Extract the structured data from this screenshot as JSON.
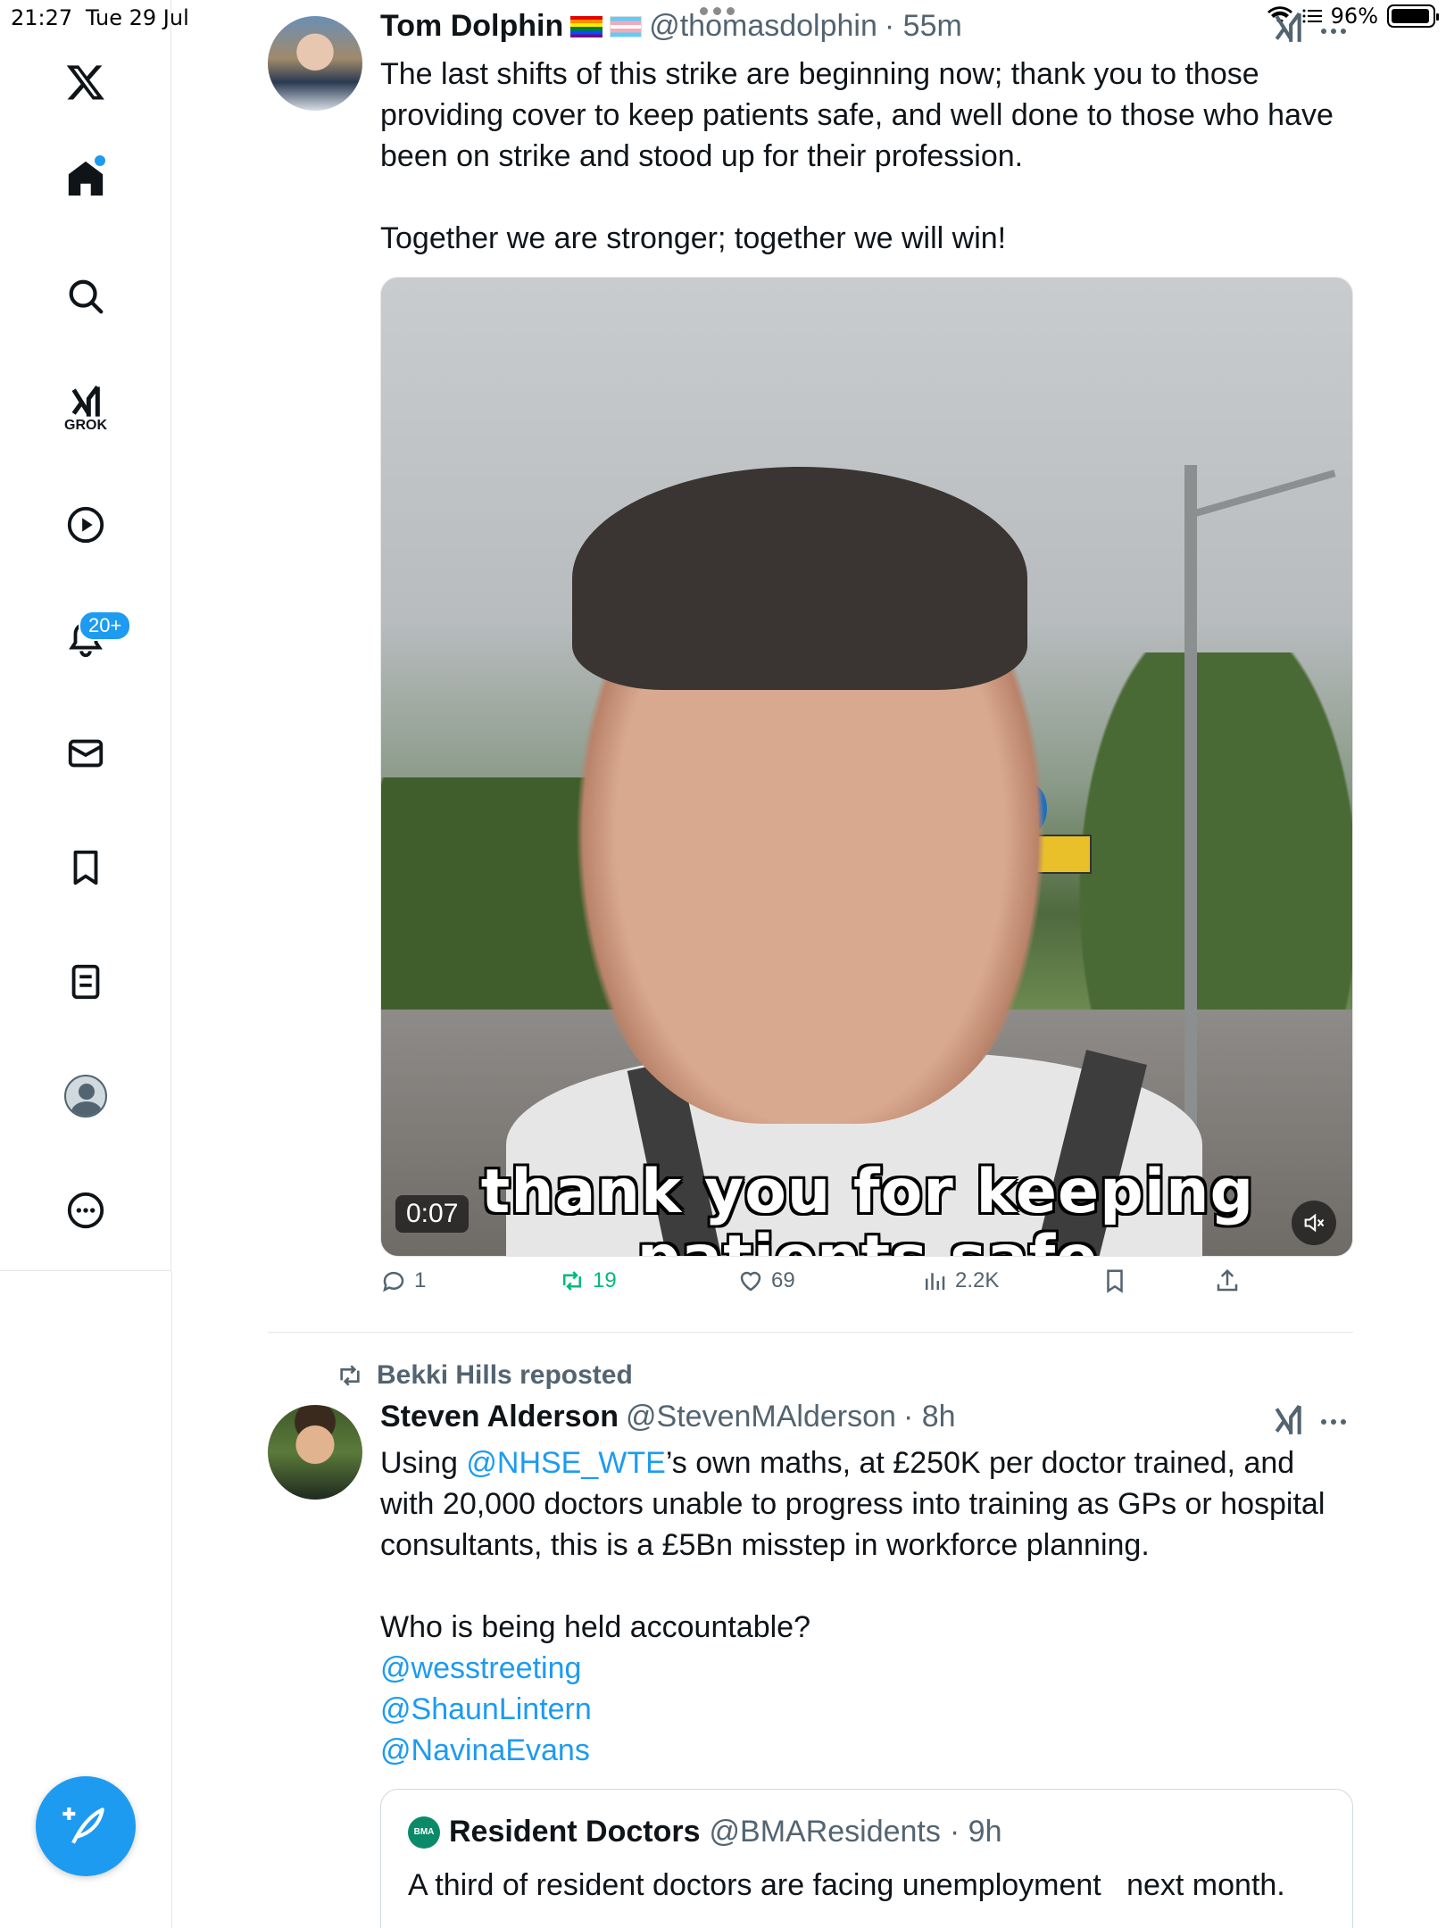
{
  "status_bar": {
    "time": "21:27",
    "date": "Tue 29 Jul",
    "battery": "96%",
    "battery_level": 0.96
  },
  "sidebar": {
    "items": [
      {
        "name": "x-logo",
        "icon": "x-logo-icon"
      },
      {
        "name": "home",
        "icon": "home-icon",
        "has_dot": true
      },
      {
        "name": "search",
        "icon": "search-icon"
      },
      {
        "name": "grok",
        "icon": "grok-icon",
        "label": "GROK"
      },
      {
        "name": "video",
        "icon": "play-icon"
      },
      {
        "name": "notifications",
        "icon": "bell-icon",
        "badge": "20+"
      },
      {
        "name": "messages",
        "icon": "mail-icon"
      },
      {
        "name": "bookmarks",
        "icon": "bookmark-icon"
      },
      {
        "name": "lists",
        "icon": "list-icon"
      },
      {
        "name": "profile",
        "icon": "avatar-icon"
      },
      {
        "name": "more",
        "icon": "more-icon"
      }
    ],
    "compose_icon": "compose-icon"
  },
  "colors": {
    "accent": "#1d9bf0",
    "text": "#0f1419",
    "muted": "#536471",
    "repost_green": "#00ba7c"
  },
  "tweet1": {
    "name": "Tom Dolphin",
    "handle": "@thomasdolphin",
    "time": "· 55m",
    "text_lines": [
      "The last shifts of this strike are beginning now; thank you to those",
      "providing cover to keep patients safe, and well done to those who have",
      "been on strike and stood up for their profession.",
      "Together we are stronger; together we will win!"
    ],
    "video": {
      "caption_line1": "thank you for keeping",
      "caption_line2": "patients safe",
      "duration": "0:07"
    },
    "actions": {
      "replies": "1",
      "reposts": "19",
      "likes": "69",
      "views": "2.2K"
    }
  },
  "tweet2": {
    "reposted_by": "Bekki Hills reposted",
    "name": "Steven Alderson",
    "handle": "@StevenMAlderson",
    "time": "· 8h",
    "text_line1_pre": "Using ",
    "text_line1_mention": "@NHSE_WTE",
    "text_line1_post": "’s own maths, at £250K per doctor trained, and",
    "text_line2": "with 20,000 doctors unable to progress into training as GPs or hospital",
    "text_line3": "consultants, this is a £5Bn misstep in workforce planning.",
    "text_line4": "Who is being held accountable?",
    "mentions": [
      "@wesstreeting",
      "@ShaunLintern",
      "@NavinaEvans"
    ],
    "quote": {
      "logo_text": "BMA",
      "name": "Resident Doctors",
      "handle": "@BMAResidents",
      "time": "· 9h",
      "text": "A third of resident doctors are facing unemployment   next month."
    }
  }
}
